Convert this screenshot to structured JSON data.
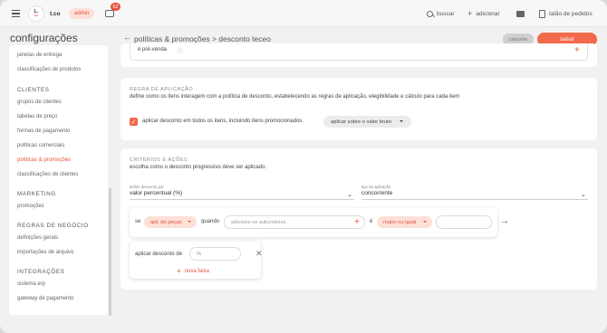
{
  "topbar": {
    "logo_text": "L.",
    "logo_sub": "ltd",
    "store_name": "t.co",
    "role_badge": "admin",
    "chat_badge_count": "62",
    "search_label": "buscar",
    "add_label": "adicionar",
    "orders_label": "talão de pedidos"
  },
  "sidebar": {
    "title": "configurações",
    "items_top": [
      "janelas de entrega",
      "classificações de produtos"
    ],
    "sections": [
      {
        "heading": "CLIENTES",
        "items": [
          "grupos de clientes",
          "tabelas de preço",
          "formas de pagamento",
          "políticas comerciais",
          "políticas & promoções",
          "classificações de clientes"
        ]
      },
      {
        "heading": "MARKETING",
        "items": [
          "promoções"
        ]
      },
      {
        "heading": "REGRAS DE NEGÓCIO",
        "items": [
          "definições gerais",
          "importações de arquivo"
        ]
      },
      {
        "heading": "INTEGRAÇÕES",
        "items": [
          "sistema erp",
          "gateway de pagamento"
        ]
      }
    ],
    "active_item": "políticas & promoções"
  },
  "header": {
    "breadcrumb": "políticas & promoções > desconto teceo",
    "cancel_label": "cancelar",
    "save_label": "salvar"
  },
  "card1": {
    "label": "é pré-venda"
  },
  "card2": {
    "section_title": "REGRA DE APLICAÇÃO",
    "description": "define como os itens interagem com a política de desconto, estabelecendo as regras de aplicação, elegibilidade e cálculo para cada item",
    "checkbox_label": "aplicar desconto em todos os itens, incluindo itens promocionados.",
    "checkbox_checked": true,
    "apply_select": "aplicar sobre o valor bruto"
  },
  "card3": {
    "section_title": "CRITÉRIOS E AÇÕES",
    "description": "escolha como o desconto progressivo deve ser aplicado.",
    "define_label": "definir desconto por",
    "define_value": "valor percentual (%)",
    "apply_type_label": "tipo de aplicação",
    "apply_type_value": "concorrente",
    "rule": {
      "se": "se",
      "condition": "qtd. de peças",
      "quando": "quando",
      "subcriteria_placeholder": "adicione os subcritérios",
      "e": "é",
      "operator": "maior ou igual"
    },
    "faixa": {
      "label": "aplicar desconto de",
      "percent_placeholder": "%",
      "new_band": "nova faixa"
    }
  },
  "colors": {
    "accent": "#f26a4b",
    "accent_text": "#e5533d",
    "accent_soft": "#fde0d8"
  }
}
